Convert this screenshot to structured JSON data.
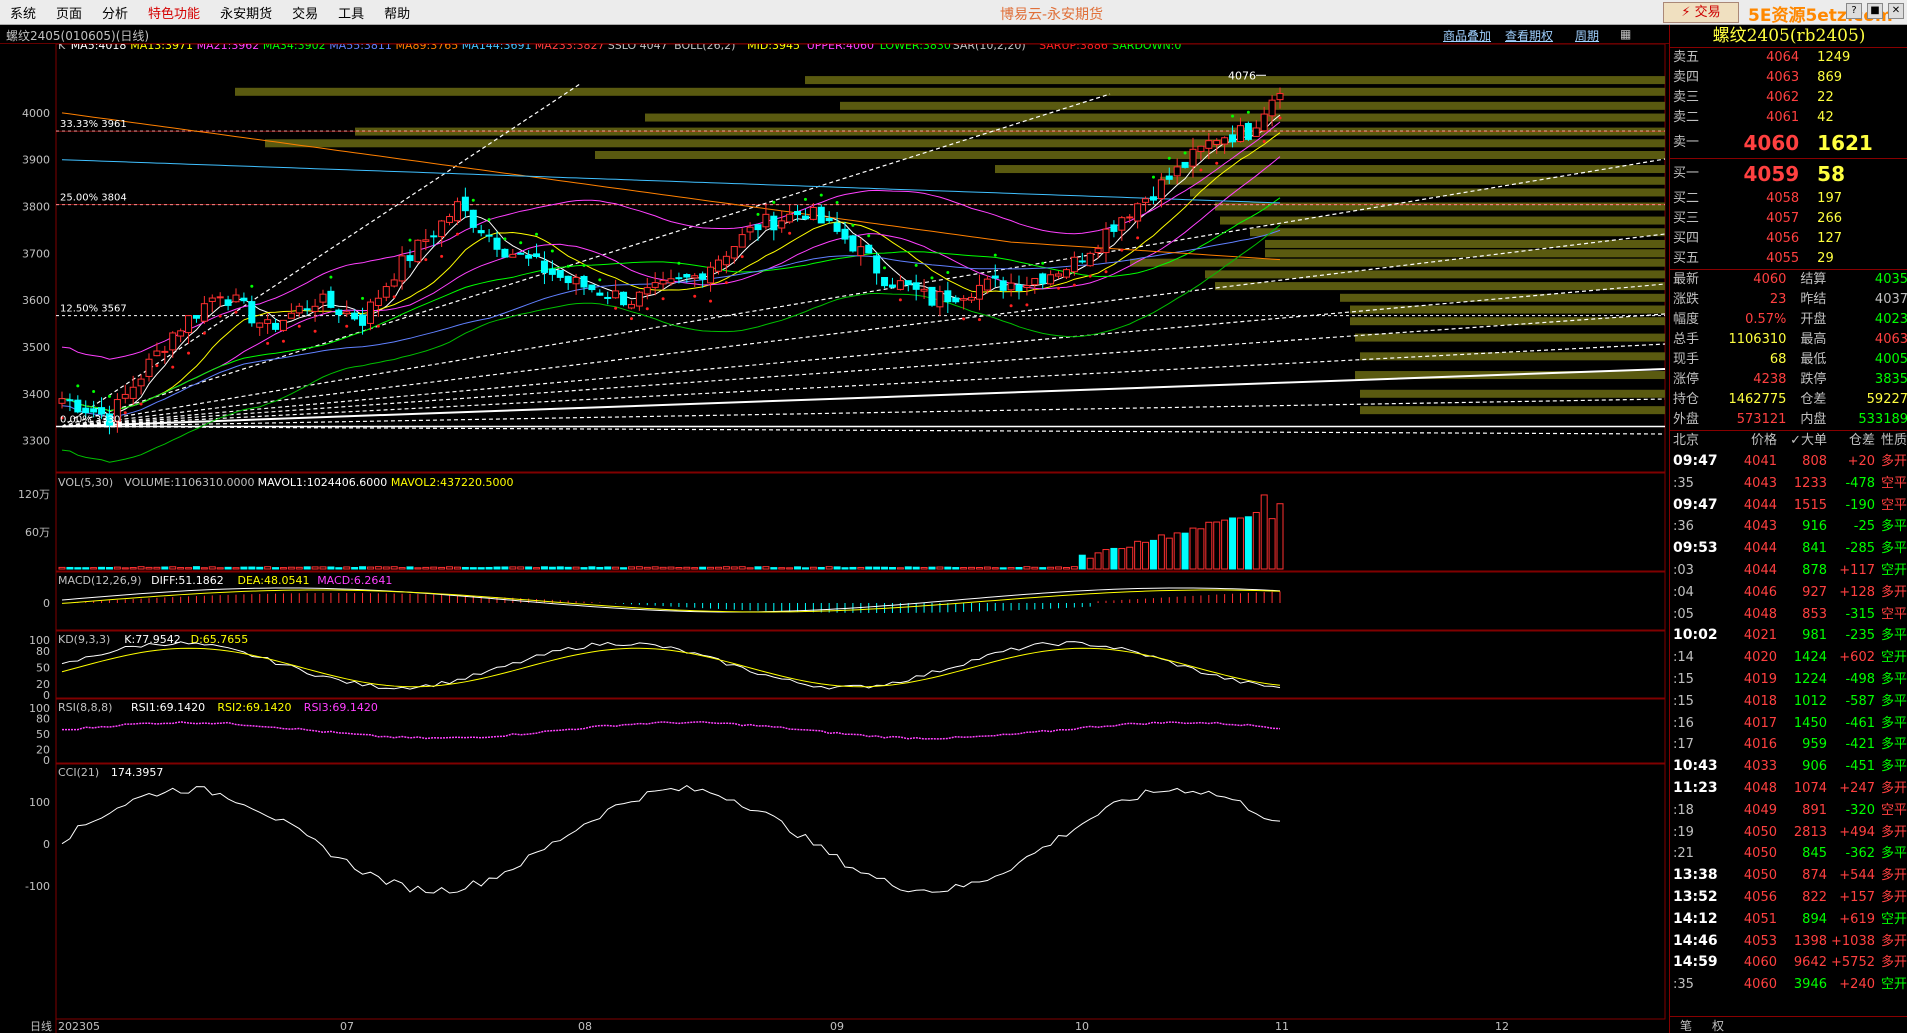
{
  "menu": [
    "系统",
    "页面",
    "分析",
    "特色功能",
    "永安期货",
    "交易",
    "工具",
    "帮助"
  ],
  "app_title": "博易云-永安期货",
  "trade_button": "⚡ 交易",
  "brand": "5E资源5etz.com",
  "window_buttons": [
    "?",
    "■",
    "✕"
  ],
  "chart_tab": "螺纹2405(010605)(日线)",
  "toolbar_links": [
    "商品叠加",
    "查看期权",
    "周期"
  ],
  "main_legend": [
    {
      "text": "K",
      "color": "#c0c0c0"
    },
    {
      "text": "MA5:4018",
      "color": "#ffffff"
    },
    {
      "text": "MA13:3971",
      "color": "#ffff00"
    },
    {
      "text": "MA21:3962",
      "color": "#ff40ff"
    },
    {
      "text": "MA34:3902",
      "color": "#00ff00"
    },
    {
      "text": "MA55:3811",
      "color": "#6080ff"
    },
    {
      "text": "MA89:3765",
      "color": "#ff8000"
    },
    {
      "text": "MA144:3691",
      "color": "#40c0ff"
    },
    {
      "text": "MA233:3827",
      "color": "#ff4040"
    },
    {
      "text": "SSLO 4047",
      "color": "#c0c0c0"
    },
    {
      "text": "BOLL(26,2)",
      "color": "#c0c0c0"
    },
    {
      "text": "MID:3945",
      "color": "#ffff00"
    },
    {
      "text": "UPPER:4060",
      "color": "#ff40ff"
    },
    {
      "text": "LOWER:3830",
      "color": "#00ff00"
    },
    {
      "text": "SAR(10,2,20)",
      "color": "#c0c0c0"
    },
    {
      "text": "SARUP:3886",
      "color": "#ff2020"
    },
    {
      "text": "SARDOWN:0",
      "color": "#00ff00"
    }
  ],
  "price_axis": [
    "4000",
    "3900",
    "3800",
    "3700",
    "3600",
    "3500",
    "3400",
    "3300"
  ],
  "fib_labels": [
    "33.33%  3961",
    "25.00%  3804",
    "12.50%  3567",
    "0.00%  3330"
  ],
  "price_marker": "4076",
  "vol_legend": [
    {
      "text": "VOL(5,30)",
      "color": "#c0c0c0"
    },
    {
      "text": "VOLUME:1106310.0000",
      "color": "#c0c0c0"
    },
    {
      "text": "MAVOL1:1024406.6000",
      "color": "#ffffff"
    },
    {
      "text": "MAVOL2:437220.5000",
      "color": "#ffff00"
    }
  ],
  "vol_axis": [
    "120万",
    "60万"
  ],
  "macd_legend": [
    {
      "text": "MACD(12,26,9)",
      "color": "#c0c0c0"
    },
    {
      "text": "DIFF:51.1862",
      "color": "#ffffff"
    },
    {
      "text": "DEA:48.0541",
      "color": "#ffff00"
    },
    {
      "text": "MACD:6.2641",
      "color": "#ff40ff"
    }
  ],
  "macd_axis": [
    "0"
  ],
  "kd_legend": [
    {
      "text": "KD(9,3,3)",
      "color": "#c0c0c0"
    },
    {
      "text": "K:77.9542",
      "color": "#ffffff"
    },
    {
      "text": "D:65.7655",
      "color": "#ffff00"
    }
  ],
  "kd_axis": [
    "100",
    "80",
    "50",
    "20",
    "0"
  ],
  "rsi_legend": [
    {
      "text": "RSI(8,8,8)",
      "color": "#c0c0c0"
    },
    {
      "text": "RSI1:69.1420",
      "color": "#ffffff"
    },
    {
      "text": "RSI2:69.1420",
      "color": "#ffff00"
    },
    {
      "text": "RSI3:69.1420",
      "color": "#ff40ff"
    }
  ],
  "rsi_axis": [
    "100",
    "80",
    "50",
    "20",
    "0"
  ],
  "cci_legend": [
    {
      "text": "CCI(21)",
      "color": "#c0c0c0"
    },
    {
      "text": "174.3957",
      "color": "#ffffff"
    }
  ],
  "cci_axis": [
    "100",
    "0",
    "-100"
  ],
  "date_axis": [
    "日线",
    "202305",
    "07",
    "08",
    "09",
    "10",
    "11",
    "12"
  ],
  "quote_title": "螺纹2405(rb2405)",
  "asks": [
    {
      "label": "卖五",
      "price": "4064",
      "vol": "1249"
    },
    {
      "label": "卖四",
      "price": "4063",
      "vol": "869"
    },
    {
      "label": "卖三",
      "price": "4062",
      "vol": "22"
    },
    {
      "label": "卖二",
      "price": "4061",
      "vol": "42"
    },
    {
      "label": "卖一",
      "price": "4060",
      "vol": "1621"
    }
  ],
  "bids": [
    {
      "label": "买一",
      "price": "4059",
      "vol": "58"
    },
    {
      "label": "买二",
      "price": "4058",
      "vol": "197"
    },
    {
      "label": "买三",
      "price": "4057",
      "vol": "266"
    },
    {
      "label": "买四",
      "price": "4056",
      "vol": "127"
    },
    {
      "label": "买五",
      "price": "4055",
      "vol": "29"
    }
  ],
  "stats": [
    {
      "l1": "最新",
      "v1": "4060",
      "c1": "#ff4040",
      "l2": "结算",
      "v2": "4035",
      "c2": "#00ff00"
    },
    {
      "l1": "涨跌",
      "v1": "23",
      "c1": "#ff4040",
      "l2": "昨结",
      "v2": "4037",
      "c2": "#c0c0c0"
    },
    {
      "l1": "幅度",
      "v1": "0.57%",
      "c1": "#ff4040",
      "l2": "开盘",
      "v2": "4023",
      "c2": "#00ff00"
    },
    {
      "l1": "总手",
      "v1": "1106310",
      "c1": "#ffff40",
      "l2": "最高",
      "v2": "4063",
      "c2": "#ff4040"
    },
    {
      "l1": "现手",
      "v1": "68",
      "c1": "#ffff40",
      "l2": "最低",
      "v2": "4005",
      "c2": "#00ff00"
    },
    {
      "l1": "涨停",
      "v1": "4238",
      "c1": "#ff4040",
      "l2": "跌停",
      "v2": "3835",
      "c2": "#00ff00"
    },
    {
      "l1": "持仓",
      "v1": "1462775",
      "c1": "#ffff40",
      "l2": "仓差",
      "v2": "59227",
      "c2": "#ffff40"
    },
    {
      "l1": "外盘",
      "v1": "573121",
      "c1": "#ff4040",
      "l2": "内盘",
      "v2": "533189",
      "c2": "#00ff00"
    }
  ],
  "ticks_header": [
    "北京",
    "价格",
    "✓大单",
    "仓差",
    "性质"
  ],
  "ticks": [
    {
      "t": "09:47",
      "big": true,
      "p": "4041",
      "v": "808",
      "d": "+20",
      "n": "多开",
      "vc": "#ff4040",
      "dc": "#ff4040",
      "nc": "#ff4040"
    },
    {
      "t": ":35",
      "big": false,
      "p": "4043",
      "v": "1233",
      "d": "-478",
      "n": "空平",
      "vc": "#ff4040",
      "dc": "#00ff00",
      "nc": "#ff4040"
    },
    {
      "t": "09:47",
      "big": true,
      "p": "4044",
      "v": "1515",
      "d": "-190",
      "n": "空平",
      "vc": "#ff4040",
      "dc": "#00ff00",
      "nc": "#ff4040"
    },
    {
      "t": ":36",
      "big": false,
      "p": "4043",
      "v": "916",
      "d": "-25",
      "n": "多平",
      "vc": "#00ff00",
      "dc": "#00ff00",
      "nc": "#00ff00"
    },
    {
      "t": "09:53",
      "big": true,
      "p": "4044",
      "v": "841",
      "d": "-285",
      "n": "多平",
      "vc": "#00ff00",
      "dc": "#00ff00",
      "nc": "#00ff00"
    },
    {
      "t": ":03",
      "big": false,
      "p": "4044",
      "v": "878",
      "d": "+117",
      "n": "空开",
      "vc": "#00ff00",
      "dc": "#ff4040",
      "nc": "#00ff00"
    },
    {
      "t": ":04",
      "big": false,
      "p": "4046",
      "v": "927",
      "d": "+128",
      "n": "多开",
      "vc": "#ff4040",
      "dc": "#ff4040",
      "nc": "#ff4040"
    },
    {
      "t": ":05",
      "big": false,
      "p": "4048",
      "v": "853",
      "d": "-315",
      "n": "空平",
      "vc": "#ff4040",
      "dc": "#00ff00",
      "nc": "#ff4040"
    },
    {
      "t": "10:02",
      "big": true,
      "p": "4021",
      "v": "981",
      "d": "-235",
      "n": "多平",
      "vc": "#00ff00",
      "dc": "#00ff00",
      "nc": "#00ff00"
    },
    {
      "t": ":14",
      "big": false,
      "p": "4020",
      "v": "1424",
      "d": "+602",
      "n": "空开",
      "vc": "#00ff00",
      "dc": "#ff4040",
      "nc": "#00ff00"
    },
    {
      "t": ":15",
      "big": false,
      "p": "4019",
      "v": "1224",
      "d": "-498",
      "n": "多平",
      "vc": "#00ff00",
      "dc": "#00ff00",
      "nc": "#00ff00"
    },
    {
      "t": ":15",
      "big": false,
      "p": "4018",
      "v": "1012",
      "d": "-587",
      "n": "多平",
      "vc": "#00ff00",
      "dc": "#00ff00",
      "nc": "#00ff00"
    },
    {
      "t": ":16",
      "big": false,
      "p": "4017",
      "v": "1450",
      "d": "-461",
      "n": "多平",
      "vc": "#00ff00",
      "dc": "#00ff00",
      "nc": "#00ff00"
    },
    {
      "t": ":17",
      "big": false,
      "p": "4016",
      "v": "959",
      "d": "-421",
      "n": "多平",
      "vc": "#00ff00",
      "dc": "#00ff00",
      "nc": "#00ff00"
    },
    {
      "t": "10:43",
      "big": true,
      "p": "4033",
      "v": "906",
      "d": "-451",
      "n": "多平",
      "vc": "#00ff00",
      "dc": "#00ff00",
      "nc": "#00ff00"
    },
    {
      "t": "11:23",
      "big": true,
      "p": "4048",
      "v": "1074",
      "d": "+247",
      "n": "多开",
      "vc": "#ff4040",
      "dc": "#ff4040",
      "nc": "#ff4040"
    },
    {
      "t": ":18",
      "big": false,
      "p": "4049",
      "v": "891",
      "d": "-320",
      "n": "空平",
      "vc": "#ff4040",
      "dc": "#00ff00",
      "nc": "#ff4040"
    },
    {
      "t": ":19",
      "big": false,
      "p": "4050",
      "v": "2813",
      "d": "+494",
      "n": "多开",
      "vc": "#ff4040",
      "dc": "#ff4040",
      "nc": "#ff4040"
    },
    {
      "t": ":21",
      "big": false,
      "p": "4050",
      "v": "845",
      "d": "-362",
      "n": "多平",
      "vc": "#00ff00",
      "dc": "#00ff00",
      "nc": "#00ff00"
    },
    {
      "t": "13:38",
      "big": true,
      "p": "4050",
      "v": "874",
      "d": "+544",
      "n": "多开",
      "vc": "#ff4040",
      "dc": "#ff4040",
      "nc": "#ff4040"
    },
    {
      "t": "13:52",
      "big": true,
      "p": "4056",
      "v": "822",
      "d": "+157",
      "n": "多开",
      "vc": "#ff4040",
      "dc": "#ff4040",
      "nc": "#ff4040"
    },
    {
      "t": "14:12",
      "big": true,
      "p": "4051",
      "v": "894",
      "d": "+619",
      "n": "空开",
      "vc": "#00ff00",
      "dc": "#ff4040",
      "nc": "#00ff00"
    },
    {
      "t": "14:46",
      "big": true,
      "p": "4053",
      "v": "1398",
      "d": "+1038",
      "n": "多开",
      "vc": "#ff4040",
      "dc": "#ff4040",
      "nc": "#ff4040"
    },
    {
      "t": "14:59",
      "big": true,
      "p": "4060",
      "v": "9642",
      "d": "+5752",
      "n": "多开",
      "vc": "#ff4040",
      "dc": "#ff4040",
      "nc": "#ff4040"
    },
    {
      "t": ":35",
      "big": false,
      "p": "4060",
      "v": "3946",
      "d": "+240",
      "n": "空开",
      "vc": "#00ff00",
      "dc": "#ff4040",
      "nc": "#00ff00"
    }
  ],
  "bottom_tabs": [
    "笔",
    "权"
  ],
  "chart_data": {
    "type": "candlestick",
    "price_ylim": [
      3250,
      4130
    ],
    "x_start": "202305",
    "candles_count": 155,
    "last_price": 4060,
    "high_marker": 4076,
    "fib_levels": [
      {
        "pct": "33.33%",
        "price": 3961
      },
      {
        "pct": "25.00%",
        "price": 3804
      },
      {
        "pct": "12.50%",
        "price": 3567
      },
      {
        "pct": "0.00%",
        "price": 3330
      }
    ]
  }
}
